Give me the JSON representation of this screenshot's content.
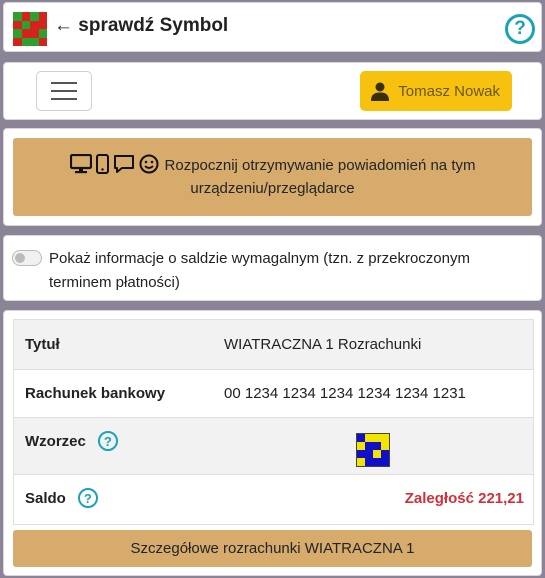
{
  "header": {
    "back_label": "← sprawdź Symbol",
    "help_label": "?",
    "logo_icon": "checkered-logo-icon"
  },
  "navbar": {
    "menu_icon": "hamburger-menu-icon",
    "user_name": "Tomasz Nowak",
    "user_icon": "user-icon",
    "user_color": "#f7c10f"
  },
  "notifications": {
    "label": "Rozpocznij otrzymywanie powiadomień na tym urządzeniu/przeglądarce",
    "icons": [
      "desktop-icon",
      "mobile-icon",
      "chat-icon",
      "smile-icon"
    ],
    "color": "#d7ab6b"
  },
  "overdue_toggle": {
    "label": "Pokaż informacje o saldzie wymagalnym (tzn. z przekroczonym terminem płatności)",
    "checked": false
  },
  "details": {
    "title_label": "Tytuł",
    "title_value": "WIATRACZNA 1 Rozrachunki",
    "account_label": "Rachunek bankowy",
    "account_value": "00 1234 1234 1234 1234 1234 1231",
    "pattern_label": "Wzorzec",
    "balance_label": "Saldo",
    "balance_value": "Zaległość 221,21",
    "balance_color": "#d32f3a",
    "help_label": "?"
  },
  "details_button": {
    "label": "Szczegółowe rozrachunki WIATRACZNA 1"
  }
}
